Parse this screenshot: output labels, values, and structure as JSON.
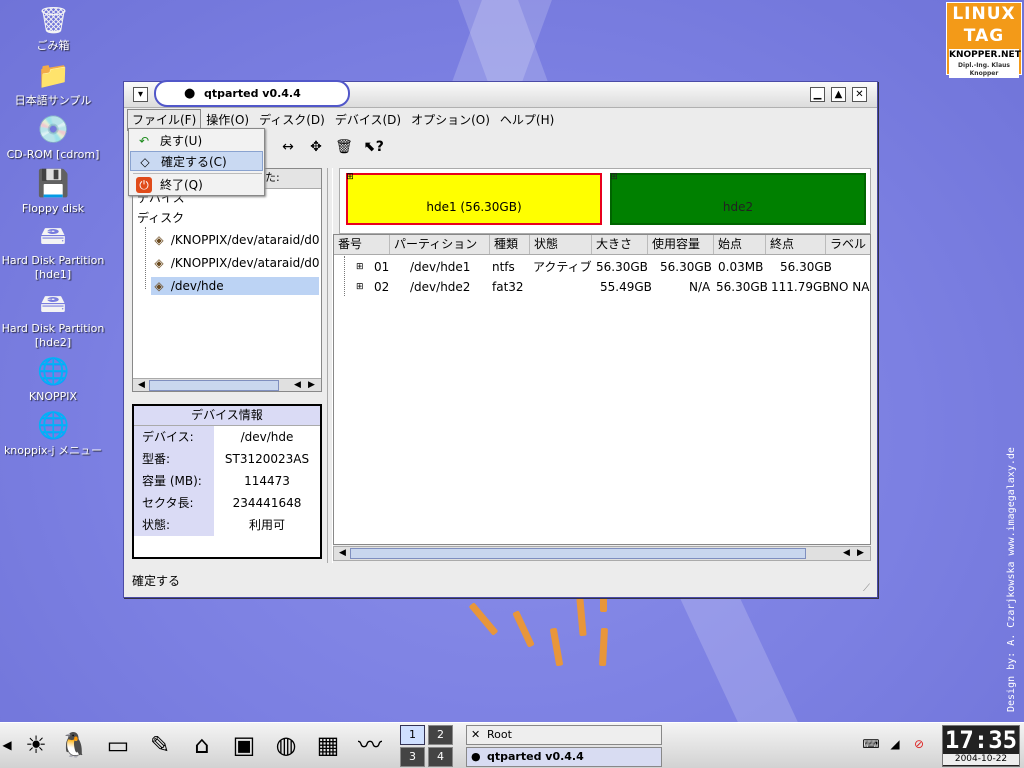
{
  "desktop": {
    "icons": [
      {
        "icon": "trash-icon",
        "glyph": "🗑",
        "label": "ごみ箱"
      },
      {
        "icon": "folder-icon",
        "glyph": "📁",
        "label": "日本語サンプル"
      },
      {
        "icon": "cdrom-icon",
        "glyph": "💿",
        "label": "CD-ROM [cdrom]"
      },
      {
        "icon": "floppy-icon",
        "glyph": "💾",
        "label": "Floppy disk"
      },
      {
        "icon": "harddisk-icon",
        "glyph": "🖴",
        "label": "Hard Disk Partition [hde1]"
      },
      {
        "icon": "harddisk-icon",
        "glyph": "🖴",
        "label": "Hard Disk Partition [hde2]"
      },
      {
        "icon": "knoppix-icon",
        "glyph": "🌐",
        "label": "KNOPPIX"
      },
      {
        "icon": "knoppix-menu-icon",
        "glyph": "🌐",
        "label": "knoppix-j メニュー"
      }
    ],
    "logo": {
      "line1": "LINUX",
      "line2": "TAG",
      "line3": "KNOPPER.NET",
      "line4": "Dipl.-Ing. Klaus Knopper"
    },
    "credit": "Design by: A. Czarjkowska  www.imagegalaxy.de"
  },
  "window": {
    "title": "qtparted v0.4.4",
    "menus": [
      "ファイル(F)",
      "操作(O)",
      "ディスク(D)",
      "デバイス(D)",
      "オプション(O)",
      "ヘルプ(H)"
    ],
    "file_menu": [
      {
        "icon": "undo-icon",
        "label": "戻す(U)"
      },
      {
        "icon": "commit-icon",
        "label": "確定する(C)"
      },
      {
        "icon": "quit-icon",
        "label": "終了(Q)"
      }
    ],
    "left_header_partial": "ました:",
    "tree": {
      "root": "デバイス",
      "group": "ディスク",
      "items": [
        "/KNOPPIX/dev/ataraid/d0",
        "/KNOPPIX/dev/ataraid/d0",
        "/dev/hde"
      ]
    },
    "device_info": {
      "title": "デバイス情報",
      "rows": [
        {
          "key": "デバイス:",
          "value": "/dev/hde"
        },
        {
          "key": "型番:",
          "value": "ST3120023AS"
        },
        {
          "key": "容量 (MB):",
          "value": "114473"
        },
        {
          "key": "セクタ長:",
          "value": "234441648"
        },
        {
          "key": "状態:",
          "value": "利用可"
        }
      ]
    },
    "partition_map": [
      {
        "label": "hde1 (56.30GB)",
        "color": "#ffff00",
        "border": "#e8001c"
      },
      {
        "label": "hde2",
        "color": "#008000",
        "border": "#006400"
      }
    ],
    "table": {
      "columns": [
        "番号",
        "パーティション",
        "種類",
        "状態",
        "大きさ",
        "使用容量",
        "始点",
        "終点",
        "ラベル"
      ],
      "rows": [
        [
          "01",
          "/dev/hde1",
          "ntfs",
          "アクティブ",
          "56.30GB",
          "56.30GB",
          "0.03MB",
          "56.30GB",
          ""
        ],
        [
          "02",
          "/dev/hde2",
          "fat32",
          "",
          "55.49GB",
          "N/A",
          "56.30GB",
          "111.79GB",
          "NO NA"
        ]
      ]
    },
    "status": "確定する"
  },
  "taskbar": {
    "desktops": [
      "1",
      "2",
      "3",
      "4"
    ],
    "tasks": [
      "Root",
      "qtparted v0.4.4"
    ],
    "clock": {
      "time": "17:35",
      "date": "2004-10-22"
    }
  }
}
